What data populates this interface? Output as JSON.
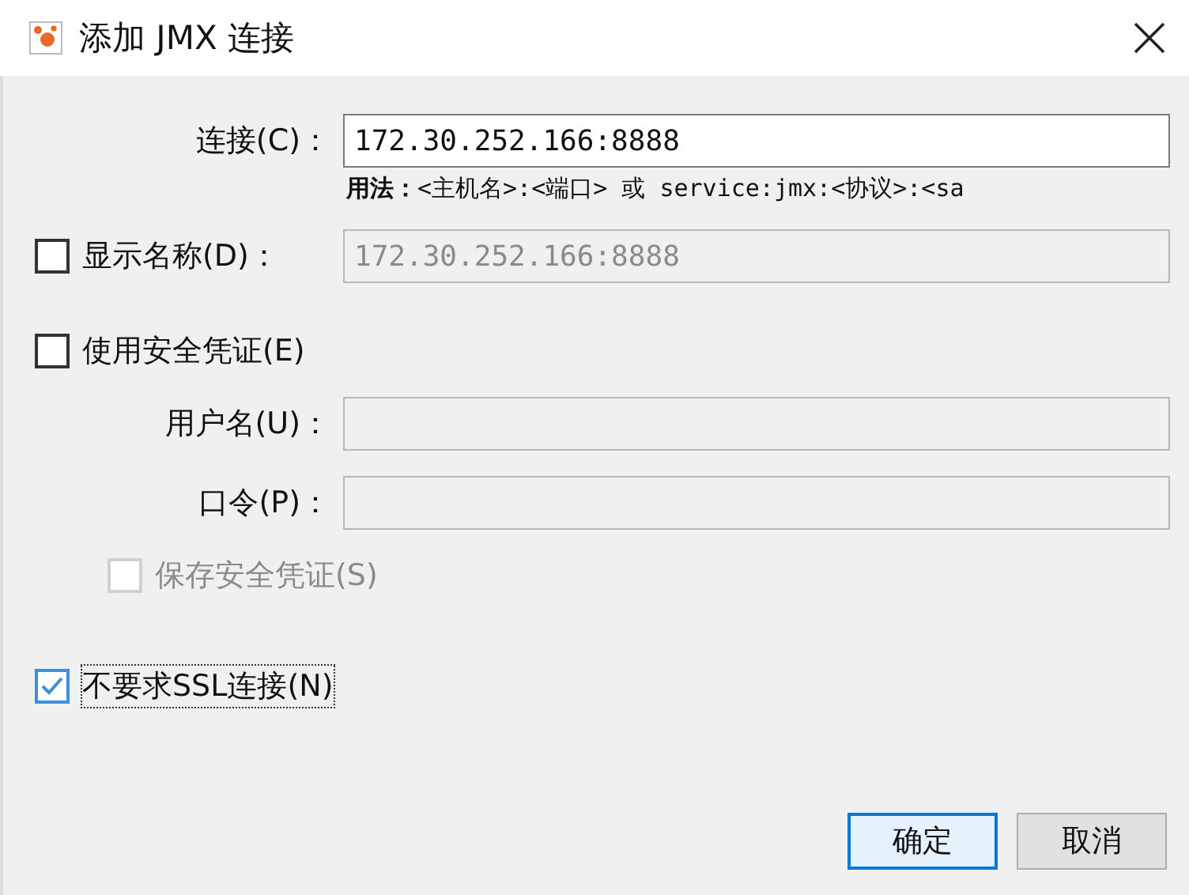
{
  "window": {
    "title": "添加 JMX 连接"
  },
  "connection": {
    "label": "连接(C)：",
    "value": "172.30.252.166:8888",
    "hint": "**用法：**<主机名>:<端口> 或 service:jmx:<协议>:<sa"
  },
  "display_name": {
    "label": "显示名称(D)：",
    "checked": false,
    "value": "172.30.252.166:8888",
    "disabled": true
  },
  "use_security": {
    "label": "使用安全凭证(E)",
    "checked": false
  },
  "username": {
    "label": "用户名(U)："
  },
  "password": {
    "label": "口令(P)："
  },
  "save_credentials": {
    "label": "保存安全凭证(S)",
    "checked": false,
    "disabled": true
  },
  "no_ssl": {
    "label": "不要求SSL连接(N)",
    "checked": true,
    "focused": true
  },
  "buttons": [
    {
      "label": "确定",
      "default": true
    },
    {
      "label": "取消",
      "default": false
    }
  ]
}
